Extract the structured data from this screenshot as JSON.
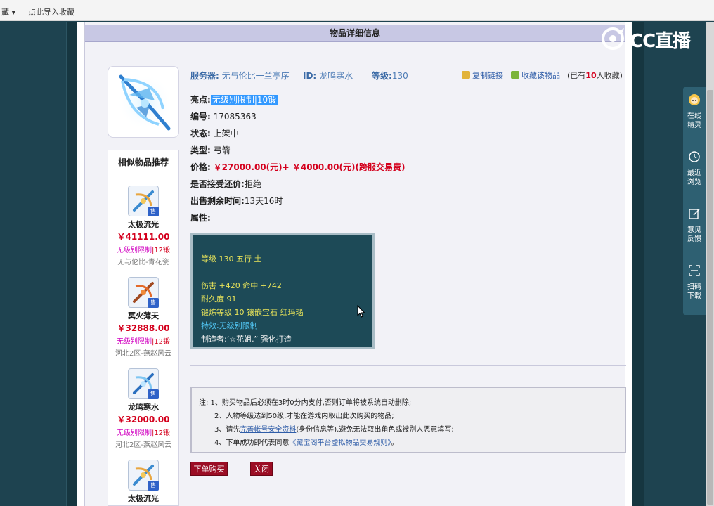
{
  "browser": {
    "fav_menu": "藏 ▾",
    "fav_add": "点此导入收藏"
  },
  "page": {
    "header_title": "物品详细信息"
  },
  "info": {
    "server_label": "服务器:",
    "server_value": "无与伦比一兰亭序",
    "id_label": "ID:",
    "id_value": "龙鸣寒水",
    "level_label": "等级:",
    "level_value": "130",
    "copy_link": "复制链接",
    "favorite_item": "收藏该物品",
    "fav_count_prefix": "(已有",
    "fav_count": "10",
    "fav_count_suffix": "人收藏)"
  },
  "details": {
    "highlight_label": "亮点:",
    "highlight_value": "无级别限制|10锻",
    "number_label": "编号:",
    "number_value": "17085363",
    "status_label": "状态:",
    "status_value": "上架中",
    "type_label": "类型:",
    "type_value": "弓箭",
    "price_label": "价格:",
    "price_value": "￥27000.00(元)+ ￥4000.00(元)(跨服交易费)",
    "counter_label": "是否接受还价:",
    "counter_value": "拒绝",
    "remaining_label": "出售剩余时间:",
    "remaining_value": "13天16时",
    "attr_label": "属性:"
  },
  "attributes": {
    "line1": "等级 130 五行 土",
    "line2": "伤害 +420 命中 +742",
    "line3": "耐久度 91",
    "line4": "锻炼等级 10 镶嵌宝石 红玛瑙",
    "line5": "特效:无级别限制",
    "line6": "制造者:’☆花姐.” 强化打造"
  },
  "similar": {
    "title": "相似物品推荐",
    "items": [
      {
        "name": "太极流光",
        "price": "￥41111.00",
        "tag": "无级别限制",
        "tag_num": "|12锻",
        "server": "无与伦比-青花瓷"
      },
      {
        "name": "冥火薄天",
        "price": "￥32888.00",
        "tag": "无级别限制",
        "tag_num": "|12锻",
        "server": "河北2区-燕赵风云"
      },
      {
        "name": "龙鸣寒水",
        "price": "￥32000.00",
        "tag": "无级别限制",
        "tag_num": "|12锻",
        "server": "河北2区-燕赵风云"
      },
      {
        "name": "太极流光",
        "price": "",
        "tag": "",
        "tag_num": "",
        "server": ""
      }
    ],
    "sell_badge": "售"
  },
  "notes": {
    "line1": "注: 1、购买物品后必须在3时0分内支付,否则订单将被系统自动删除;",
    "line2": "2、人物等级达到50级,才能在游戏内取出此次购买的物品;",
    "line3_pre": "3、请先",
    "line3_link": "完善帐号安全资料",
    "line3_post": "(身份信息等),避免无法取出角色或被别人恶意填写;",
    "line4_pre": "4、下单成功即代表同意",
    "line4_link": "《藏宝阁平台虚拟物品交易规则》",
    "line4_post": "。"
  },
  "buttons": {
    "buy": "下单购买",
    "close": "关闭"
  },
  "overlay": {
    "logo_text": "CC直播"
  },
  "float_panel": {
    "items": [
      {
        "label": "在线精灵"
      },
      {
        "label": "最近浏览"
      },
      {
        "label": "意见反馈"
      },
      {
        "label": "扫码下载"
      }
    ]
  },
  "colors": {
    "header_bg": "#c8c8e4",
    "price_red": "#d4001d",
    "link_blue": "#2f5da8",
    "button_red": "#9b0d24",
    "attr_bg": "#1d4a57",
    "attr_yellow": "#e6e25a",
    "highlight_blue": "#3399ff"
  }
}
